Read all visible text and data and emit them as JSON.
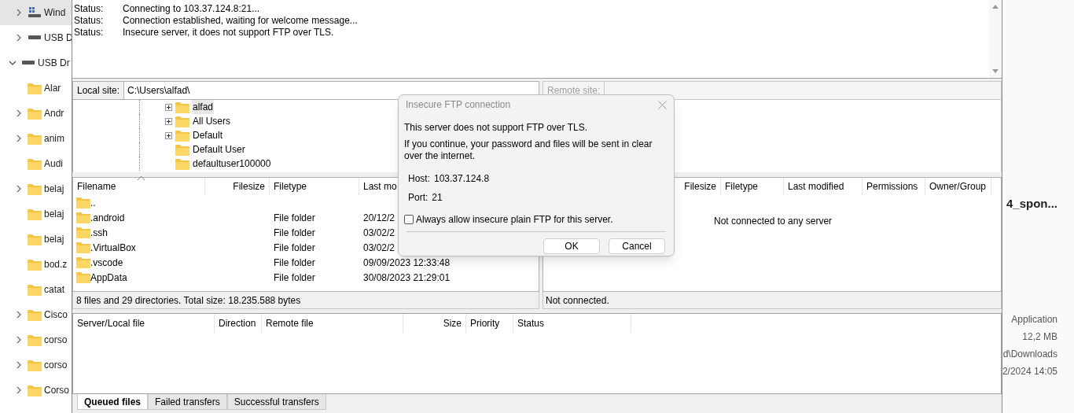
{
  "explorer_left": {
    "items": [
      {
        "label": "Wind",
        "kind": "system-drive",
        "expandable": true,
        "expanded": false,
        "selected": true
      },
      {
        "label": "USB D",
        "kind": "drive",
        "expandable": true,
        "expanded": false,
        "selected": false
      },
      {
        "label": "USB Dr",
        "kind": "drive",
        "expandable": true,
        "expanded": true,
        "selected": false,
        "children": [
          {
            "label": "Alar",
            "kind": "folder",
            "expandable": false,
            "selected": false
          },
          {
            "label": "Andr",
            "kind": "folder",
            "expandable": true,
            "expanded": false,
            "selected": false
          },
          {
            "label": "anim",
            "kind": "folder",
            "expandable": true,
            "expanded": false,
            "selected": false
          },
          {
            "label": "Audi",
            "kind": "folder",
            "expandable": false,
            "selected": false
          },
          {
            "label": "belaj",
            "kind": "folder",
            "expandable": true,
            "expanded": false,
            "selected": false
          },
          {
            "label": "belaj",
            "kind": "folder",
            "expandable": false,
            "selected": false
          },
          {
            "label": "belaj",
            "kind": "folder",
            "expandable": false,
            "selected": false
          },
          {
            "label": "bod.z",
            "kind": "folder",
            "expandable": false,
            "selected": false
          },
          {
            "label": "catat",
            "kind": "folder",
            "expandable": false,
            "selected": false
          },
          {
            "label": "Cisco",
            "kind": "folder",
            "expandable": true,
            "expanded": false,
            "selected": false
          },
          {
            "label": "corso",
            "kind": "folder",
            "expandable": true,
            "expanded": false,
            "selected": false
          },
          {
            "label": "corso",
            "kind": "folder",
            "expandable": true,
            "expanded": false,
            "selected": false
          },
          {
            "label": "Corso",
            "kind": "folder",
            "expandable": true,
            "expanded": false,
            "selected": false
          }
        ]
      }
    ]
  },
  "explorer_right": {
    "title": "4_spon...",
    "details": [
      "Application",
      "12,2 MB",
      "d\\Downloads",
      "2/2024 14:05"
    ]
  },
  "message_log": [
    {
      "label": "Status:",
      "text": "Connecting to 103.37.124.8:21..."
    },
    {
      "label": "Status:",
      "text": "Connection established, waiting for welcome message..."
    },
    {
      "label": "Status:",
      "text": "Insecure server, it does not support FTP over TLS."
    }
  ],
  "local_site": {
    "label": "Local site:",
    "value": "C:\\Users\\alfad\\"
  },
  "local_tree": [
    {
      "name": "alfad",
      "expandable": true,
      "selected": true
    },
    {
      "name": "All Users",
      "expandable": true,
      "selected": false
    },
    {
      "name": "Default",
      "expandable": true,
      "selected": false
    },
    {
      "name": "Default User",
      "expandable": false,
      "selected": false
    },
    {
      "name": "defaultuser100000",
      "expandable": false,
      "selected": false
    }
  ],
  "local_files": {
    "columns": [
      "Filename",
      "Filesize",
      "Filetype",
      "Last mo"
    ],
    "rows": [
      {
        "name": ".."
      },
      {
        "name": ".android",
        "type": "File folder",
        "modified": "20/12/2"
      },
      {
        "name": ".ssh",
        "type": "File folder",
        "modified": "03/02/2"
      },
      {
        "name": ".VirtualBox",
        "type": "File folder",
        "modified": "03/02/2"
      },
      {
        "name": ".vscode",
        "type": "File folder",
        "modified": "09/09/2023 12:33:48"
      },
      {
        "name": "AppData",
        "type": "File folder",
        "modified": "30/08/2023 21:29:01"
      }
    ]
  },
  "local_status": "8 files and 29 directories. Total size: 18.235.588 bytes",
  "remote_site": {
    "label": "Remote site:",
    "disabled": true
  },
  "remote_files": {
    "columns": [
      "Filesize",
      "Filetype",
      "Last modified",
      "Permissions",
      "Owner/Group"
    ],
    "empty_message": "Not connected to any server"
  },
  "remote_status": "Not connected.",
  "queue": {
    "columns": [
      "Server/Local file",
      "Direction",
      "Remote file",
      "Size",
      "Priority",
      "Status"
    ]
  },
  "tabs": [
    {
      "label": "Queued files",
      "selected": true
    },
    {
      "label": "Failed transfers",
      "selected": false
    },
    {
      "label": "Successful transfers",
      "selected": false
    }
  ],
  "dialog": {
    "title": "Insecure FTP connection",
    "message": "This server does not support FTP over TLS.",
    "detail": "If you continue, your password and files will be sent in clear over the internet.",
    "fields": [
      {
        "label": "Host:",
        "value": "103.37.124.8"
      },
      {
        "label": "Port:",
        "value": "21"
      }
    ],
    "checkbox": {
      "label": "Always allow insecure plain FTP for this server.",
      "checked": false
    },
    "buttons": [
      "OK",
      "Cancel"
    ]
  }
}
